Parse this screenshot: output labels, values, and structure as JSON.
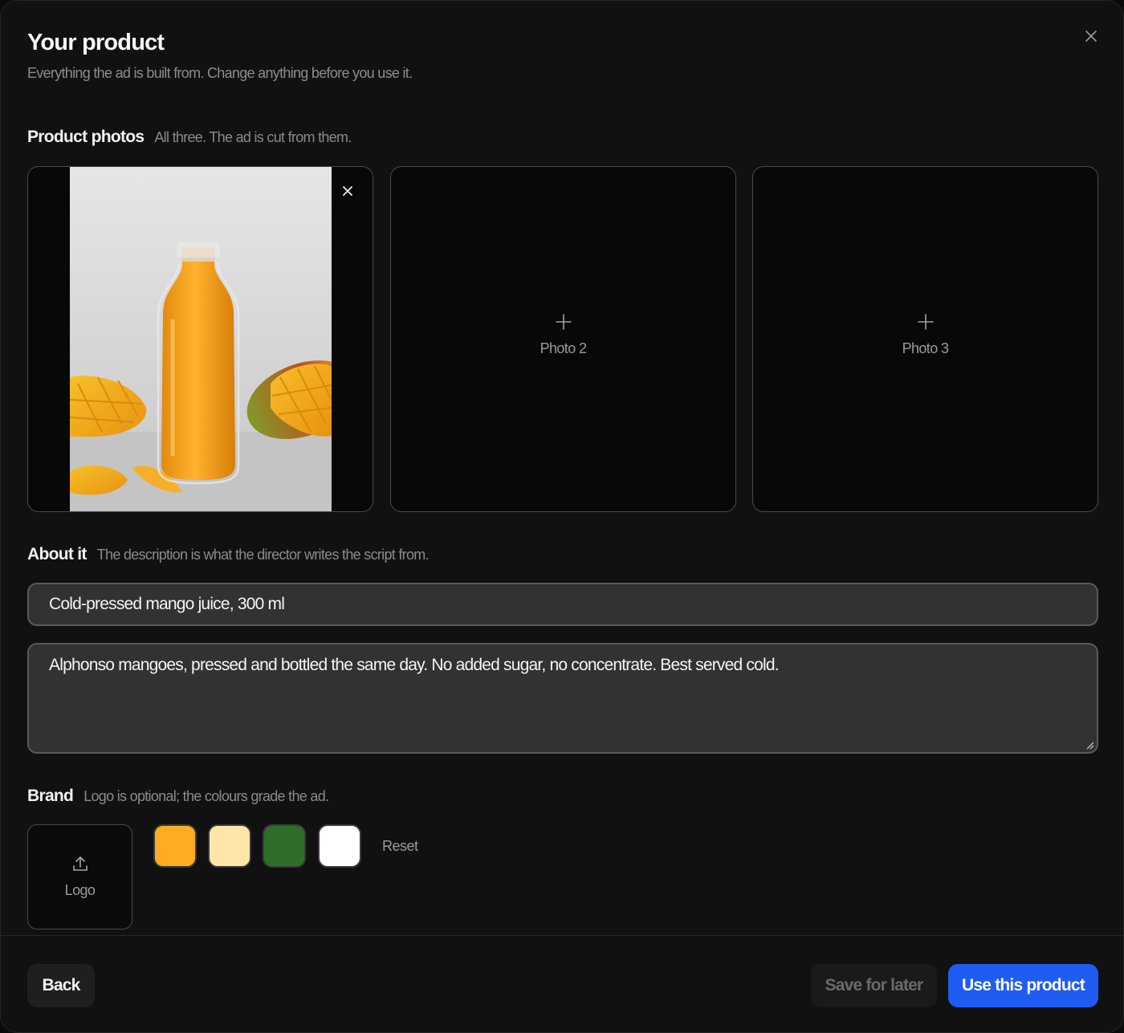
{
  "dialog": {
    "title": "Your product",
    "subtitle": "Everything the ad is built from. Change anything before you use it."
  },
  "photos": {
    "heading": "Product photos",
    "hint": "All three. The ad is cut from them.",
    "slots": [
      {
        "label": "",
        "filled": true,
        "content": "mango-juice-bottle-photo"
      },
      {
        "label": "Photo 2",
        "filled": false
      },
      {
        "label": "Photo 3",
        "filled": false
      }
    ]
  },
  "about": {
    "heading": "About it",
    "hint": "The description is what the director writes the script from.",
    "name_value": "Cold-pressed mango juice, 300 ml",
    "description_value": "Alphonso mangoes, pressed and bottled the same day. No added sugar, no concentrate. Best served cold."
  },
  "brand": {
    "heading": "Brand",
    "hint": "Logo is optional; the colours grade the ad.",
    "logo_label": "Logo",
    "colors": [
      "#FFAC24",
      "#FFE6A8",
      "#2E6E28",
      "#FFFFFF"
    ],
    "reset_label": "Reset"
  },
  "footer": {
    "back_label": "Back",
    "save_label": "Save for later",
    "use_label": "Use this product"
  },
  "icons": {
    "close": "close-icon",
    "remove": "close-icon",
    "add": "plus-icon",
    "upload": "upload-icon"
  },
  "theme": {
    "accent": "#1F5CF2",
    "background": "#111111"
  }
}
